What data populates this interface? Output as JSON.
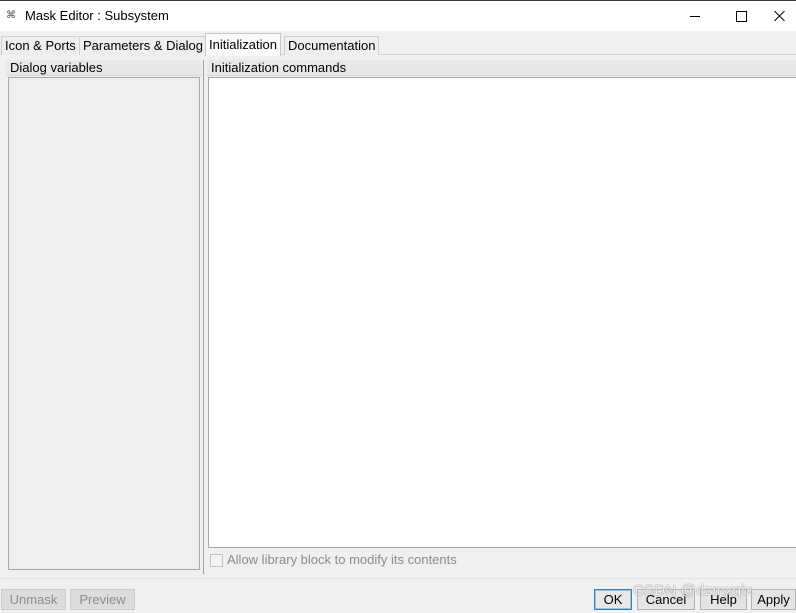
{
  "window": {
    "app_icon": "simulink-mask-icon",
    "title": "Mask Editor : Subsystem",
    "controls": [
      "minimize-icon",
      "maximize-icon",
      "close-icon"
    ]
  },
  "tabs": [
    {
      "label": "Icon & Ports",
      "active": false
    },
    {
      "label": "Parameters & Dialog",
      "active": false
    },
    {
      "label": "Initialization",
      "active": true
    },
    {
      "label": "Documentation",
      "active": false
    }
  ],
  "left_panel": {
    "header": "Dialog variables",
    "variables": []
  },
  "right_panel": {
    "header": "Initialization commands",
    "commands": "",
    "allow_library_modify": {
      "label": "Allow library block to modify its contents",
      "checked": false,
      "enabled": false
    }
  },
  "footer": {
    "unmask_label": "Unmask",
    "preview_label": "Preview",
    "ok_label": "OK",
    "cancel_label": "Cancel",
    "help_label": "Help",
    "apply_label": "Apply"
  },
  "watermark": "CSDN @dzmxqlx",
  "colors": {
    "window_bg": "#f0f0f0",
    "editor_bg": "#ffffff",
    "default_button_border": "#3c7fb1",
    "disabled_text": "#8c8c8c"
  }
}
